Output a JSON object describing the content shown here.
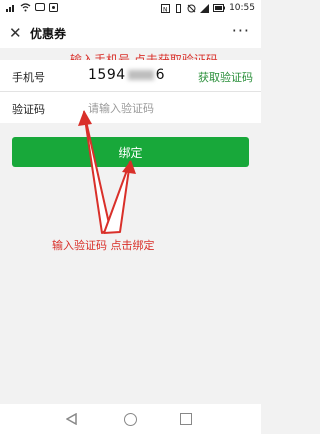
{
  "status_bar": {
    "time": "10:55",
    "icons_left": [
      "signal-icon",
      "wifi-icon",
      "message-icon",
      "notification-icon"
    ],
    "icons_right": [
      "nfc-icon",
      "vibrate-icon",
      "alarm-icon",
      "cellular-icon",
      "battery-icon"
    ]
  },
  "nav": {
    "close_icon": "✕",
    "title": "优惠券",
    "more_icon": "···"
  },
  "form": {
    "phone_label": "手机号",
    "phone_value_start": "1594",
    "phone_value_end": "6",
    "get_code_label": "获取验证码",
    "code_label": "验证码",
    "code_placeholder": "请输入验证码"
  },
  "bind_button_label": "绑定",
  "annotations": {
    "top": "输入手机号 点击获取验证码",
    "bottom": "输入验证码 点击绑定",
    "color": "#d9302a"
  },
  "colors": {
    "accent": "#18a83a",
    "link_green": "#2a8f3a"
  }
}
